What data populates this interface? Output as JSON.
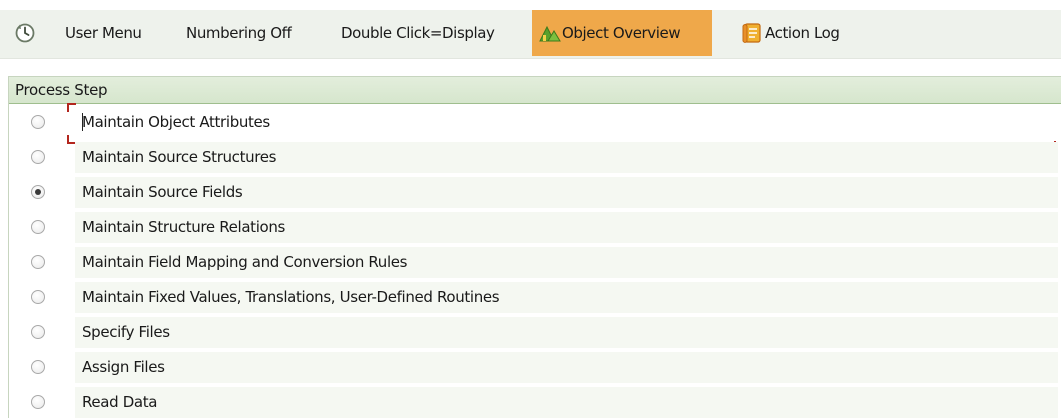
{
  "toolbar": {
    "items": [
      {
        "label": "",
        "icon": "clock-icon"
      },
      {
        "label": "User Menu"
      },
      {
        "label": "Numbering Off"
      },
      {
        "label": "Double Click=Display"
      },
      {
        "label": "Object Overview",
        "icon": "object-overview-icon",
        "active": true
      },
      {
        "label": "Action Log",
        "icon": "action-log-icon"
      }
    ],
    "active_color": "#efa84a"
  },
  "panel": {
    "header": "Process Step"
  },
  "steps": [
    {
      "label": "Maintain Object Attributes",
      "selected": false,
      "focused": true
    },
    {
      "label": "Maintain Source Structures",
      "selected": false
    },
    {
      "label": "Maintain Source Fields",
      "selected": true
    },
    {
      "label": "Maintain Structure Relations",
      "selected": false
    },
    {
      "label": "Maintain Field Mapping and Conversion Rules",
      "selected": false
    },
    {
      "label": "Maintain Fixed Values, Translations, User-Defined Routines",
      "selected": false
    },
    {
      "label": "Specify Files",
      "selected": false
    },
    {
      "label": "Assign Files",
      "selected": false
    },
    {
      "label": "Read Data",
      "selected": false
    }
  ],
  "colors": {
    "toolbar_bg": "#eef2ec",
    "header_bg": "#d6e6cd",
    "field_bg": "#f5f8f2",
    "focus_bracket": "#b3261e"
  }
}
